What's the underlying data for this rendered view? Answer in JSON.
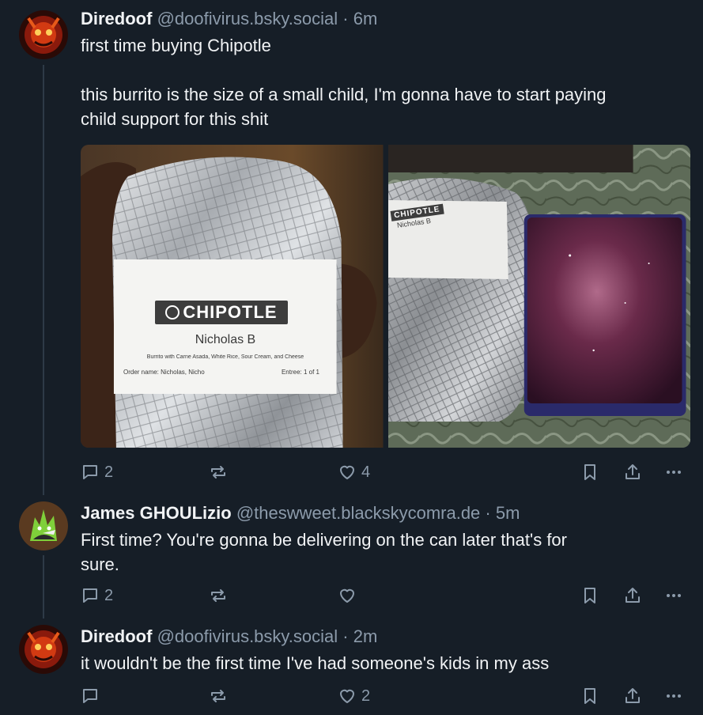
{
  "posts": [
    {
      "name": "Diredoof",
      "handle": "@doofivirus.bsky.social",
      "separator": "·",
      "time": "6m",
      "text_line1": "first time buying Chipotle",
      "text_line2": "this burrito is the size of a small child, I'm gonna have to start paying",
      "text_line3": "child support for this shit",
      "image1": {
        "brand": "CHIPOTLE",
        "customer": "Nicholas B",
        "order_desc": "Burrito with Carne Asada, White Rice, Sour Cream, and Cheese",
        "order_name": "Order name: Nicholas, Nicho",
        "entree": "Entree: 1 of 1"
      },
      "image2": {
        "brand": "CHIPOTLE",
        "customer": "Nicholas B"
      },
      "replies": "2",
      "reposts": "",
      "likes": "4"
    },
    {
      "name": "James GHOULizio",
      "handle": "@theswweet.blackskycomra.de",
      "separator": "·",
      "time": "5m",
      "text_line1": "First time? You're gonna be delivering on the can later that's for",
      "text_line2": "sure.",
      "replies": "2",
      "reposts": "",
      "likes": ""
    },
    {
      "name": "Diredoof",
      "handle": "@doofivirus.bsky.social",
      "separator": "·",
      "time": "2m",
      "text_line1": "it wouldn't be the first time I've had someone's kids in my ass",
      "replies": "",
      "reposts": "",
      "likes": "2"
    }
  ],
  "icons": {
    "reply": "reply-icon",
    "repost": "repost-icon",
    "like": "heart-icon",
    "bookmark": "bookmark-icon",
    "share": "share-icon",
    "more": "more-icon"
  },
  "colors": {
    "background": "#161e27",
    "text": "#f1f3f5",
    "muted": "#8c9bab",
    "thread_line": "#2e3a47"
  }
}
